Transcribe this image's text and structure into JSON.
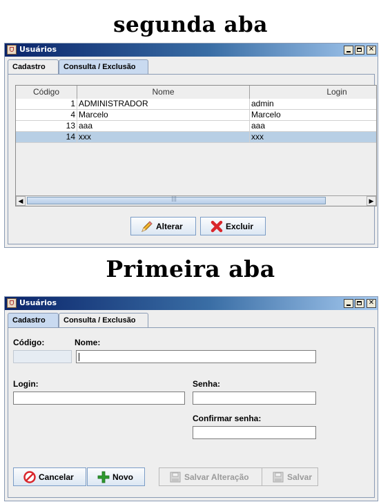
{
  "captions": {
    "top": "segunda aba",
    "middle": "Primeira aba"
  },
  "window": {
    "title": "Usuários"
  },
  "tabs": [
    {
      "label": "Cadastro"
    },
    {
      "label": "Consulta / Exclusão"
    }
  ],
  "consulta": {
    "columns": [
      "Código",
      "Nome",
      "Login"
    ],
    "rows": [
      {
        "codigo": "1",
        "nome": "ADMINISTRADOR",
        "login": "admin"
      },
      {
        "codigo": "4",
        "nome": "Marcelo",
        "login": "Marcelo"
      },
      {
        "codigo": "13",
        "nome": "aaa",
        "login": "aaa"
      },
      {
        "codigo": "14",
        "nome": "xxx",
        "login": "xxx"
      }
    ],
    "selected_row": 3,
    "buttons": {
      "alterar": "Alterar",
      "excluir": "Excluir"
    }
  },
  "cadastro": {
    "labels": {
      "codigo": "Código:",
      "nome": "Nome:",
      "login": "Login:",
      "senha": "Senha:",
      "confirmar": "Confirmar senha:"
    },
    "values": {
      "codigo": "",
      "nome": "",
      "login": "",
      "senha": "",
      "confirmar": ""
    },
    "buttons": {
      "cancelar": "Cancelar",
      "novo": "Novo",
      "salvar_alteracao": "Salvar Alteração",
      "salvar": "Salvar"
    }
  },
  "colors": {
    "title_start": "#0a246a",
    "title_end": "#a6caf0",
    "selection": "#b8cfe5",
    "danger": "#d9262c",
    "add": "#2e9a2e"
  },
  "icons": [
    "java-cup-icon",
    "minimize-icon",
    "maximize-icon",
    "close-icon",
    "pencil-icon",
    "x-delete-icon",
    "cancel-icon",
    "plus-icon",
    "disk-save-icon"
  ]
}
